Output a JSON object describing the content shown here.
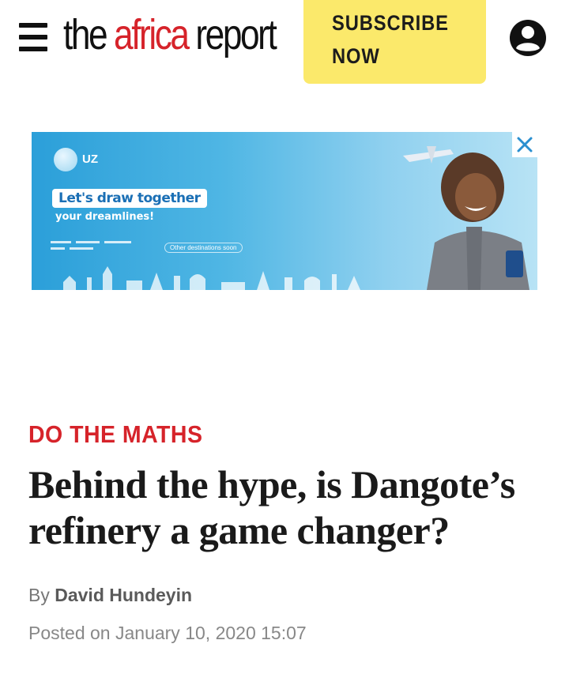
{
  "header": {
    "logo": {
      "part1": "the ",
      "part2": "africa",
      "part3": " report"
    },
    "subscribe": {
      "line1": "SUBSCRIBE",
      "line2": "NOW"
    },
    "icons": {
      "menu": "hamburger-menu-icon",
      "account": "user-account-icon"
    }
  },
  "ad": {
    "brand": "UZ",
    "headline_highlight": "Let's draw together",
    "headline_sub": "your dreamlines!",
    "cta": "Other destinations soon",
    "close_icon": "close-icon",
    "colors": {
      "background": "#4fb6e4",
      "accent": "#1a6fb5"
    }
  },
  "article": {
    "kicker": "DO THE MATHS",
    "headline": "Behind the hype, is Dangote’s refinery a game changer?",
    "by_label": "By",
    "author": "David Hundeyin",
    "posted_label": "Posted on",
    "date": "January 10, 2020 15:07"
  },
  "colors": {
    "brand_red": "#d6232a",
    "subscribe_yellow": "#fbe96b"
  }
}
